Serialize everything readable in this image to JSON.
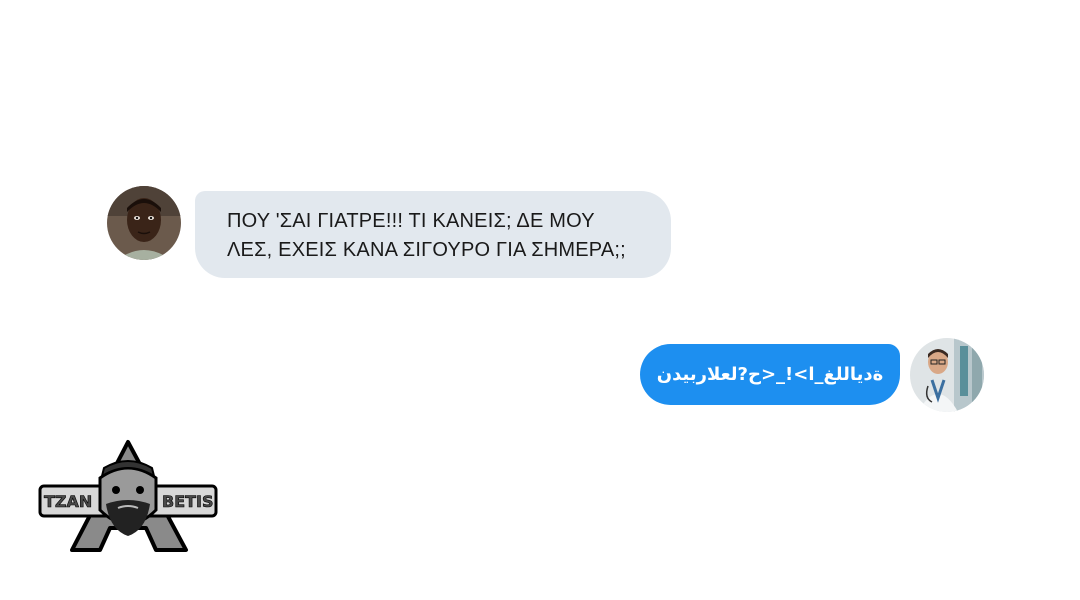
{
  "chat": {
    "incoming": {
      "avatar_icon": "person-avatar-icon",
      "text": "ΠΟΥ 'ΣΑΙ ΓΙΑΤΡΕ!!! ΤΙ ΚΑΝΕΙΣ; ΔΕ ΜΟΥ ΛΕΣ, ΕΧΕΙΣ ΚΑΝΑ ΣΙΓΟΥΡΟ ΓΙΑ ΣΗΜΕΡΑ;;",
      "bubble_color": "#e2e8ee"
    },
    "outgoing": {
      "avatar_icon": "doctor-avatar-icon",
      "text": "ةدياللغ_ا>!_<ح?لعلاربيدن",
      "bubble_color": "#1d8ff0"
    }
  },
  "watermark": {
    "text_left": "TZAN",
    "text_right": "BETIS",
    "icon": "bearded-man-logo-icon"
  }
}
